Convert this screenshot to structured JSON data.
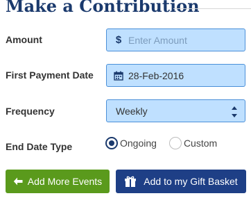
{
  "header": {
    "title": "Make a Contribution"
  },
  "form": {
    "amount": {
      "label": "Amount",
      "icon": "dollar-sign-icon",
      "prefix": "$",
      "placeholder": "Enter Amount",
      "value": ""
    },
    "first_payment": {
      "label": "First Payment Date",
      "icon": "calendar-icon",
      "value": "28-Feb-2016"
    },
    "frequency": {
      "label": "Frequency",
      "value": "Weekly",
      "icon": "select-arrows-icon"
    },
    "end_date_type": {
      "label": "End Date Type",
      "options": [
        {
          "label": "Ongoing",
          "selected": true
        },
        {
          "label": "Custom",
          "selected": false
        }
      ]
    }
  },
  "actions": {
    "add_more": {
      "label": "Add More Events",
      "icon": "arrow-left-icon",
      "color": "#5a9a1c"
    },
    "add_basket": {
      "label": "Add to my Gift Basket",
      "icon": "gift-icon",
      "color": "#1e3f86"
    }
  },
  "colors": {
    "title": "#1b3a6d",
    "field_bg": "#bfe0ff",
    "field_border": "#4a8fd8"
  }
}
